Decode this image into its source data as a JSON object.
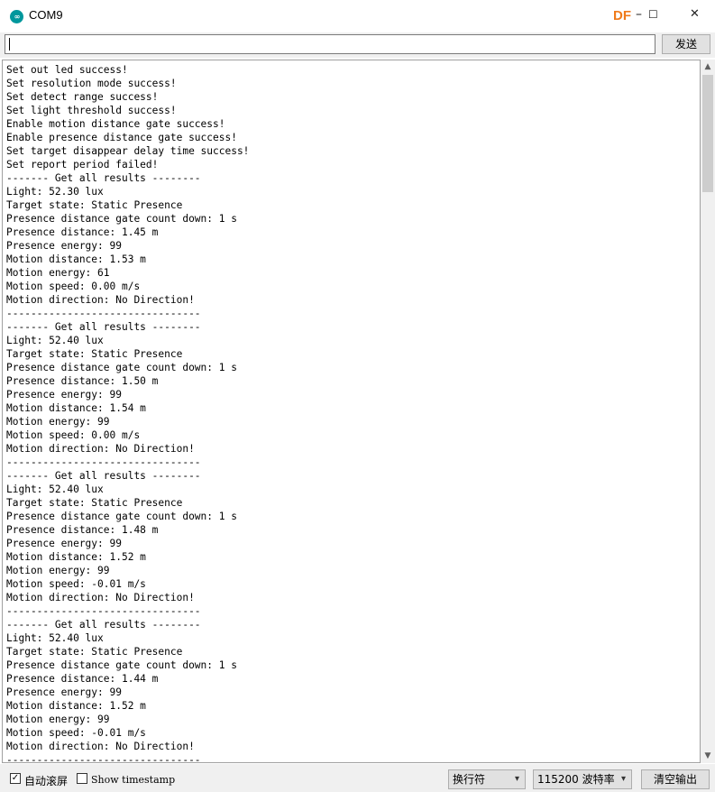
{
  "window": {
    "title": "COM9",
    "app_icon": "arduino-icon",
    "controls": {
      "minimize": "–",
      "maximize": "☐",
      "close": "✕"
    },
    "watermark": "DF"
  },
  "send": {
    "input_value": "",
    "button_label": "发送"
  },
  "output_lines": [
    "Set out led success!",
    "Set resolution mode success!",
    "Set detect range success!",
    "Set light threshold success!",
    "Enable motion distance gate success!",
    "Enable presence distance gate success!",
    "Set target disappear delay time success!",
    "Set report period failed!",
    "------- Get all results --------",
    "Light: 52.30 lux",
    "Target state: Static Presence",
    "Presence distance gate count down: 1 s",
    "Presence distance: 1.45 m",
    "Presence energy: 99",
    "Motion distance: 1.53 m",
    "Motion energy: 61",
    "Motion speed: 0.00 m/s",
    "Motion direction: No Direction!",
    "--------------------------------",
    "------- Get all results --------",
    "Light: 52.40 lux",
    "Target state: Static Presence",
    "Presence distance gate count down: 1 s",
    "Presence distance: 1.50 m",
    "Presence energy: 99",
    "Motion distance: 1.54 m",
    "Motion energy: 99",
    "Motion speed: 0.00 m/s",
    "Motion direction: No Direction!",
    "--------------------------------",
    "------- Get all results --------",
    "Light: 52.40 lux",
    "Target state: Static Presence",
    "Presence distance gate count down: 1 s",
    "Presence distance: 1.48 m",
    "Presence energy: 99",
    "Motion distance: 1.52 m",
    "Motion energy: 99",
    "Motion speed: -0.01 m/s",
    "Motion direction: No Direction!",
    "--------------------------------",
    "------- Get all results --------",
    "Light: 52.40 lux",
    "Target state: Static Presence",
    "Presence distance gate count down: 1 s",
    "Presence distance: 1.44 m",
    "Presence energy: 99",
    "Motion distance: 1.52 m",
    "Motion energy: 99",
    "Motion speed: -0.01 m/s",
    "Motion direction: No Direction!",
    "--------------------------------"
  ],
  "status": {
    "autoscroll_label": "自动滚屏",
    "autoscroll_checked": true,
    "timestamp_label": "Show timestamp",
    "timestamp_checked": false,
    "line_ending": "换行符",
    "baud_rate": "115200 波特率",
    "clear_label": "清空输出"
  },
  "colors": {
    "arduino_teal": "#00979c",
    "df_orange": "#f07a1a"
  }
}
